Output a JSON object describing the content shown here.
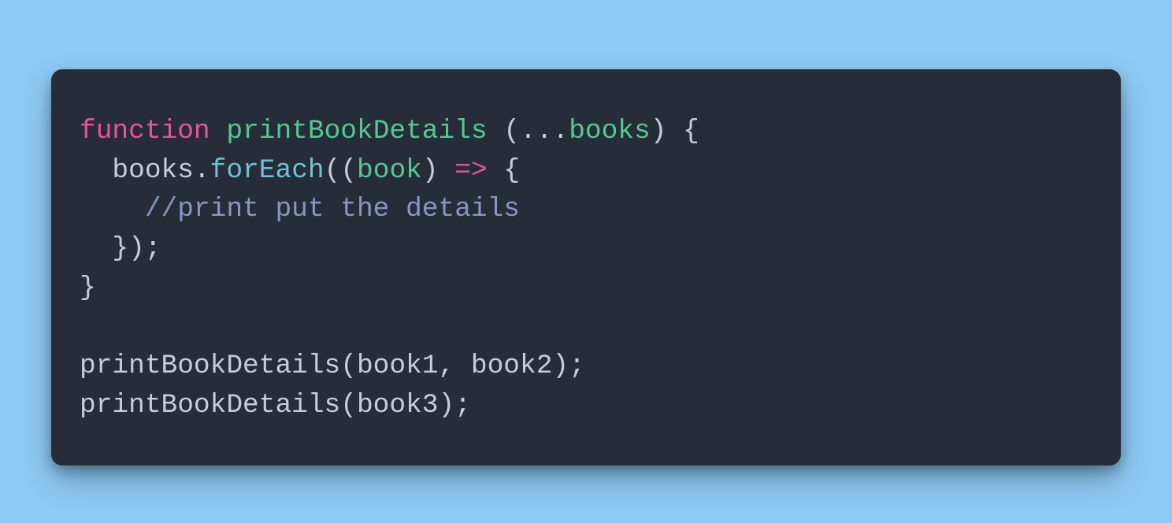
{
  "colors": {
    "page_bg": "#8ecaf5",
    "card_bg": "#272c39",
    "text_default": "#c7ccd6",
    "keyword": "#e9539a",
    "funcname": "#54c991",
    "method": "#6cc3d7",
    "param": "#54c991",
    "arrow": "#e9539a",
    "comment": "#8a95c4"
  },
  "code": {
    "l1": {
      "function": "function",
      "space1": " ",
      "name": "printBookDetails",
      "space2": " ",
      "open": "(",
      "spread": "...",
      "param": "books",
      "close": ") {"
    },
    "l2": {
      "indent": "  ",
      "obj": "books",
      "dot": ".",
      "method": "forEach",
      "open": "((",
      "param": "book",
      "close": ") ",
      "arrow": "=>",
      "brace": " {"
    },
    "l3": {
      "indent": "    ",
      "comment": "//print put the details"
    },
    "l4": {
      "indent": "  ",
      "text": "});"
    },
    "l5": {
      "text": "}"
    },
    "l6": {
      "text": ""
    },
    "l7": {
      "text": "printBookDetails(book1, book2);"
    },
    "l8": {
      "text": "printBookDetails(book3);"
    }
  }
}
